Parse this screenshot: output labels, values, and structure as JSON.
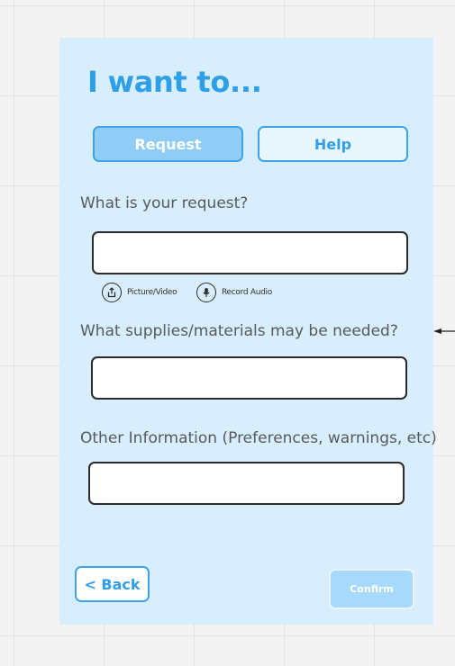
{
  "form": {
    "title": "I want to...",
    "tabs": {
      "request_label": "Request",
      "help_label": "Help"
    },
    "questions": {
      "request": "What is your request?",
      "supplies": "What supplies/materials may be needed?",
      "other": "Other Information (Preferences, warnings, etc)"
    },
    "fields": {
      "request_value": "",
      "supplies_value": "",
      "other_value": ""
    },
    "attachments": {
      "picture_label": "Picture/Video",
      "picture_icon": "share-upload-icon",
      "audio_label": "Record Audio",
      "audio_icon": "microphone-icon"
    },
    "buttons": {
      "back_label": "< Back",
      "confirm_label": "Confirm"
    }
  },
  "colors": {
    "canvas": "#f3f3f3",
    "card": "#d9eefc",
    "accent": "#2f9fe8",
    "tab_active": "#8fcdf6",
    "confirm_disabled": "#a7d9fa",
    "field_border": "#2b2b2b"
  }
}
